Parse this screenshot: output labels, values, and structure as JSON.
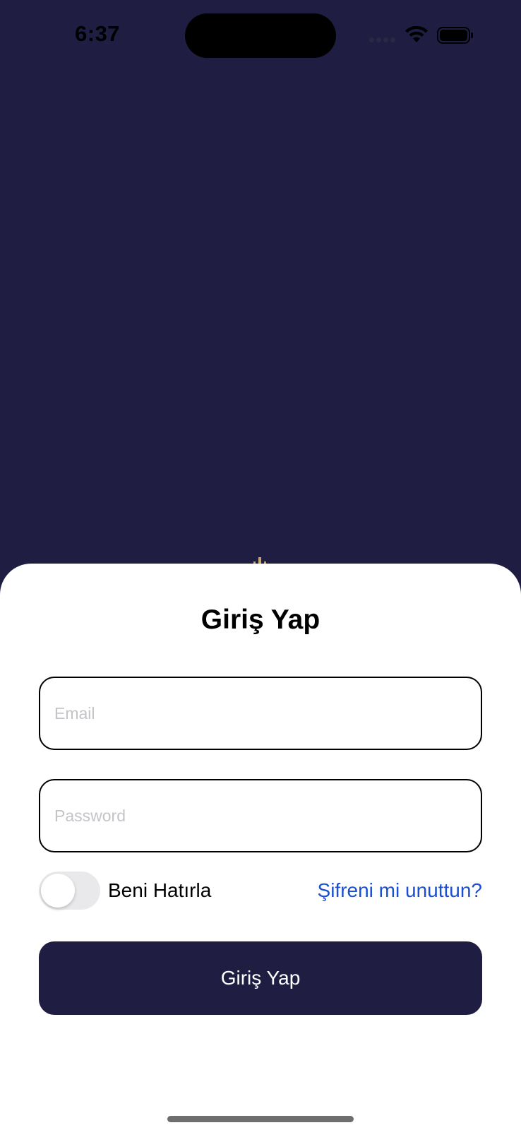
{
  "status_bar": {
    "time": "6:37",
    "icons": [
      "signal-icon",
      "wifi-icon",
      "battery-icon"
    ]
  },
  "colors": {
    "background": "#1f1e42",
    "sheet": "#ffffff",
    "accent_link": "#1b4fd1",
    "button": "#1f1e42",
    "logo": "#c9a56a"
  },
  "login": {
    "title": "Giriş Yap",
    "email_placeholder": "Email",
    "email_value": "",
    "password_placeholder": "Password",
    "password_value": "",
    "remember_label": "Beni Hatırla",
    "remember_on": false,
    "forgot_link": "Şifreni mi unuttun?",
    "submit_label": "Giriş Yap"
  }
}
